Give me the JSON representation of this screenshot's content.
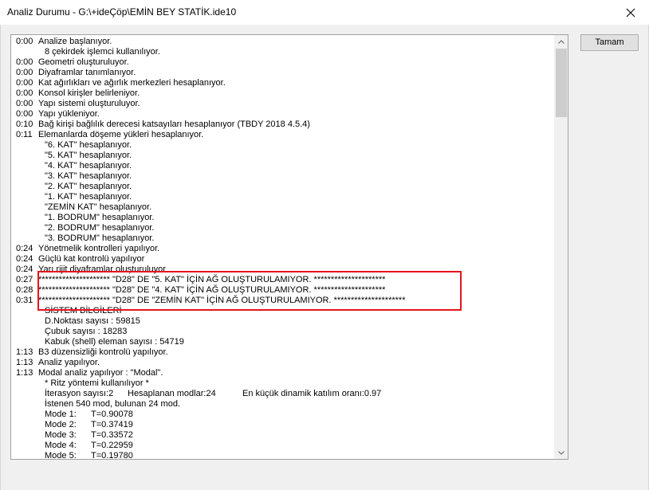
{
  "window": {
    "title": "Analiz Durumu - G:\\+ideÇöp\\EMİN BEY STATİK.ide10",
    "close_symbol": "✕"
  },
  "ok_button": {
    "label": "Tamam"
  },
  "log": {
    "lines": [
      {
        "time": "0:00",
        "text": "Analize başlanıyor."
      },
      {
        "time": "",
        "text": "8 çekirdek işlemci kullanılıyor.",
        "indent": 2
      },
      {
        "time": "0:00",
        "text": "Geometri oluşturuluyor."
      },
      {
        "time": "0:00",
        "text": "Diyaframlar tanımlanıyor."
      },
      {
        "time": "0:00",
        "text": "Kat ağırlıkları ve ağırlık merkezleri hesaplanıyor."
      },
      {
        "time": "0:00",
        "text": "Konsol kirişler belirleniyor."
      },
      {
        "time": "0:00",
        "text": "Yapı sistemi oluşturuluyor."
      },
      {
        "time": "0:00",
        "text": "Yapı yükleniyor."
      },
      {
        "time": "0:10",
        "text": "Bağ kirişi bağlılık derecesi katsayıları hesaplanıyor (TBDY 2018 4.5.4)"
      },
      {
        "time": "0:11",
        "text": "Elemanlarda döşeme yükleri hesaplanıyor."
      },
      {
        "time": "",
        "text": "\"6. KAT\" hesaplanıyor.",
        "indent": 2
      },
      {
        "time": "",
        "text": "\"5. KAT\" hesaplanıyor.",
        "indent": 2
      },
      {
        "time": "",
        "text": "\"4. KAT\" hesaplanıyor.",
        "indent": 2
      },
      {
        "time": "",
        "text": "\"3. KAT\" hesaplanıyor.",
        "indent": 2
      },
      {
        "time": "",
        "text": "\"2. KAT\" hesaplanıyor.",
        "indent": 2
      },
      {
        "time": "",
        "text": "\"1. KAT\" hesaplanıyor.",
        "indent": 2
      },
      {
        "time": "",
        "text": "\"ZEMİN KAT\" hesaplanıyor.",
        "indent": 2
      },
      {
        "time": "",
        "text": "\"1. BODRUM\" hesaplanıyor.",
        "indent": 2
      },
      {
        "time": "",
        "text": "\"2. BODRUM\" hesaplanıyor.",
        "indent": 2
      },
      {
        "time": "",
        "text": "\"3. BODRUM\" hesaplanıyor.",
        "indent": 2
      },
      {
        "time": "0:24",
        "text": "Yönetmelik kontrolleri yapılıyor."
      },
      {
        "time": "0:24",
        "text": "Güçlü kat kontrolü yapılıyor"
      },
      {
        "time": "0:24",
        "text": "Yarı rijit diyaframlar oluşturuluyor"
      },
      {
        "time": "0:27",
        "text": "********************* \"D28\" DE \"5. KAT\" İÇİN AĞ OLUŞTURULAMIYOR. *********************"
      },
      {
        "time": "0:28",
        "text": "********************* \"D28\" DE \"4. KAT\" İÇİN AĞ OLUŞTURULAMIYOR. *********************"
      },
      {
        "time": "0:31",
        "text": "********************* \"D28\" DE \"ZEMİN KAT\" İÇİN AĞ OLUŞTURULAMIYOR. *********************"
      },
      {
        "time": "",
        "text": "SİSTEM BİLGİLERİ",
        "indent": 2
      },
      {
        "time": "",
        "text": "D.Noktası sayısı : 59815",
        "indent": 2
      },
      {
        "time": "",
        "text": "Çubuk sayısı : 18283",
        "indent": 2
      },
      {
        "time": "",
        "text": "Kabuk (shell) eleman sayısı : 54719",
        "indent": 2
      },
      {
        "time": "1:13",
        "text": "B3 düzensizliği kontrolü yapılıyor."
      },
      {
        "time": "1:13",
        "text": "Analiz yapılıyor."
      },
      {
        "time": "1:13",
        "text": "Modal analiz yapılıyor : \"Modal\"."
      },
      {
        "time": "",
        "text": "* Ritz yöntemi kullanılıyor *",
        "indent": 2
      },
      {
        "time": "",
        "cols": [
          "İterasyon sayısı:2",
          "Hesaplanan modlar:24",
          "En küçük dinamik katılım oranı:0.97"
        ]
      },
      {
        "time": "",
        "text": "İstenen 540 mod, bulunan 24 mod.",
        "indent": 2
      },
      {
        "time": "",
        "cols": [
          "Mode 1:",
          "T=0.90078"
        ],
        "mode": true
      },
      {
        "time": "",
        "cols": [
          "Mode 2:",
          "T=0.37419"
        ],
        "mode": true
      },
      {
        "time": "",
        "cols": [
          "Mode 3:",
          "T=0.33572"
        ],
        "mode": true
      },
      {
        "time": "",
        "cols": [
          "Mode 4:",
          "T=0.22959"
        ],
        "mode": true
      },
      {
        "time": "",
        "cols": [
          "Mode 5:",
          "T=0.19780"
        ],
        "mode": true
      }
    ]
  },
  "highlight": {
    "color": "#e5141c"
  }
}
